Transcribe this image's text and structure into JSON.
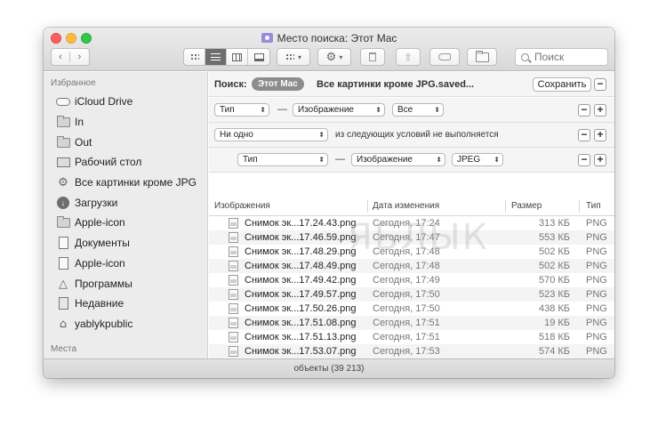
{
  "window": {
    "title": "Место поиска: Этот Mac"
  },
  "toolbar": {
    "search_placeholder": "Поиск"
  },
  "sidebar": {
    "favorites_header": "Избранное",
    "places_header": "Места",
    "items": [
      {
        "label": "iCloud Drive",
        "icon": "cloud-icon"
      },
      {
        "label": "In",
        "icon": "folder-icon"
      },
      {
        "label": "Out",
        "icon": "folder-icon"
      },
      {
        "label": "Рабочий стол",
        "icon": "desktop-icon"
      },
      {
        "label": "Все картинки кроме JPG",
        "icon": "gear-icon"
      },
      {
        "label": "Загрузки",
        "icon": "download-icon"
      },
      {
        "label": "Apple-icon",
        "icon": "folder-icon"
      },
      {
        "label": "Документы",
        "icon": "documents-icon"
      },
      {
        "label": "Apple-icon",
        "icon": "document-icon"
      },
      {
        "label": "Программы",
        "icon": "applications-icon"
      },
      {
        "label": "Недавние",
        "icon": "recents-icon"
      },
      {
        "label": "yablykpublic",
        "icon": "home-icon"
      }
    ]
  },
  "search_bar": {
    "label": "Поиск:",
    "scope": "Этот Mac",
    "saved_name": "Все картинки кроме JPG.saved...",
    "save_button": "Сохранить"
  },
  "criteria": {
    "row1": {
      "attribute": "Тип",
      "dash": "—",
      "value": "Изображение",
      "qualifier": "Все"
    },
    "row2": {
      "mode": "Ни одно",
      "text": "из следующих условий не выполняется"
    },
    "row3": {
      "attribute": "Тип",
      "dash": "—",
      "value": "Изображение",
      "qualifier": "JPEG"
    },
    "minus": "−",
    "plus": "+"
  },
  "table": {
    "columns": [
      "Изображения",
      "Дата изменения",
      "Размер",
      "Тип"
    ],
    "rows": [
      {
        "name": "Снимок эк...17.24.43.png",
        "date": "Сегодня, 17:24",
        "size": "313 КБ",
        "kind": "PNG"
      },
      {
        "name": "Снимок эк...17.46.59.png",
        "date": "Сегодня, 17:47",
        "size": "553 КБ",
        "kind": "PNG"
      },
      {
        "name": "Снимок эк...17.48.29.png",
        "date": "Сегодня, 17:48",
        "size": "502 КБ",
        "kind": "PNG"
      },
      {
        "name": "Снимок эк...17.48.49.png",
        "date": "Сегодня, 17:48",
        "size": "502 КБ",
        "kind": "PNG"
      },
      {
        "name": "Снимок эк...17.49.42.png",
        "date": "Сегодня, 17:49",
        "size": "570 КБ",
        "kind": "PNG"
      },
      {
        "name": "Снимок эк...17.49.57.png",
        "date": "Сегодня, 17:50",
        "size": "523 КБ",
        "kind": "PNG"
      },
      {
        "name": "Снимок эк...17.50.26.png",
        "date": "Сегодня, 17:50",
        "size": "438 КБ",
        "kind": "PNG"
      },
      {
        "name": "Снимок эк...17.51.08.png",
        "date": "Сегодня, 17:51",
        "size": "19 КБ",
        "kind": "PNG"
      },
      {
        "name": "Снимок эк...17.51.13.png",
        "date": "Сегодня, 17:51",
        "size": "518 КБ",
        "kind": "PNG"
      },
      {
        "name": "Снимок эк...17.53.07.png",
        "date": "Сегодня, 17:53",
        "size": "574 КБ",
        "kind": "PNG"
      }
    ]
  },
  "watermark": "ЯБЛЫК",
  "status": {
    "text": "объекты (39 213)"
  }
}
